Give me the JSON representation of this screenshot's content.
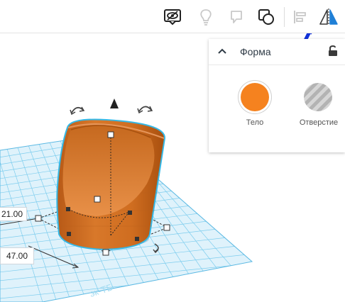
{
  "toolbar": {
    "icons": [
      "eye-toggle-icon",
      "lightbulb-icon",
      "speech-bubble-icon",
      "group-icon",
      "align-icon",
      "mirror-icon"
    ]
  },
  "panel": {
    "title": "Форма",
    "solid_label": "Тело",
    "hole_label": "Отверстие",
    "solid_color": "#f5821f",
    "hole_color": "#bcbcbc"
  },
  "canvas": {
    "dim_width": "21.00",
    "dim_length": "47.00",
    "grid_watermark": "эк-ТБ"
  },
  "colors": {
    "grid": "#6fc8ec",
    "shape": "#d26e1e",
    "selection_outline": "#35b8e6",
    "arrow": "#1232d8"
  }
}
